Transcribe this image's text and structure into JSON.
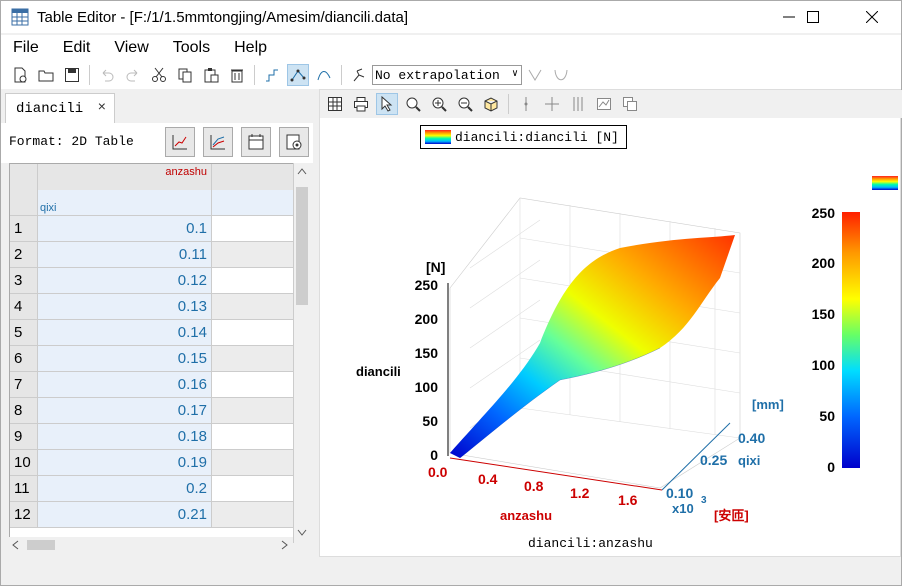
{
  "window": {
    "title": "Table Editor - [F:/1/1.5mmtongjing/Amesim/diancili.data]"
  },
  "menu": [
    "File",
    "Edit",
    "View",
    "Tools",
    "Help"
  ],
  "toolbar": {
    "extrapolation": "No extrapolation"
  },
  "tab": {
    "label": "diancili",
    "close": "×"
  },
  "format": {
    "label": "Format: 2D Table"
  },
  "table": {
    "col_x_label": "qixi",
    "col_y_label": "anzashu",
    "rows": [
      {
        "n": "1",
        "v": "0.1"
      },
      {
        "n": "2",
        "v": "0.11"
      },
      {
        "n": "3",
        "v": "0.12"
      },
      {
        "n": "4",
        "v": "0.13"
      },
      {
        "n": "5",
        "v": "0.14"
      },
      {
        "n": "6",
        "v": "0.15"
      },
      {
        "n": "7",
        "v": "0.16"
      },
      {
        "n": "8",
        "v": "0.17"
      },
      {
        "n": "9",
        "v": "0.18"
      },
      {
        "n": "10",
        "v": "0.19"
      },
      {
        "n": "11",
        "v": "0.2"
      },
      {
        "n": "12",
        "v": "0.21"
      }
    ]
  },
  "chart_data": {
    "type": "surface",
    "legend": "diancili:diancili [N]",
    "zlabel": "diancili",
    "zunit": "[N]",
    "zticks": [
      "0",
      "50",
      "100",
      "150",
      "200",
      "250"
    ],
    "xlabel": "anzashu",
    "xunit": "[安匝]",
    "xticks": [
      "0.0",
      "0.4",
      "0.8",
      "1.2",
      "1.6"
    ],
    "xmultiplier": "x10",
    "xexponent": "3",
    "ylabel": "qixi",
    "yunit": "[mm]",
    "yticks": [
      "0.10",
      "0.25",
      "0.40"
    ],
    "colorbar_ticks": [
      "0",
      "50",
      "100",
      "150",
      "200",
      "250"
    ],
    "bottom_label": "diancili:anzashu",
    "colors": {
      "x_axis": "#cc0000",
      "y_axis": "#1f6fa8"
    }
  }
}
